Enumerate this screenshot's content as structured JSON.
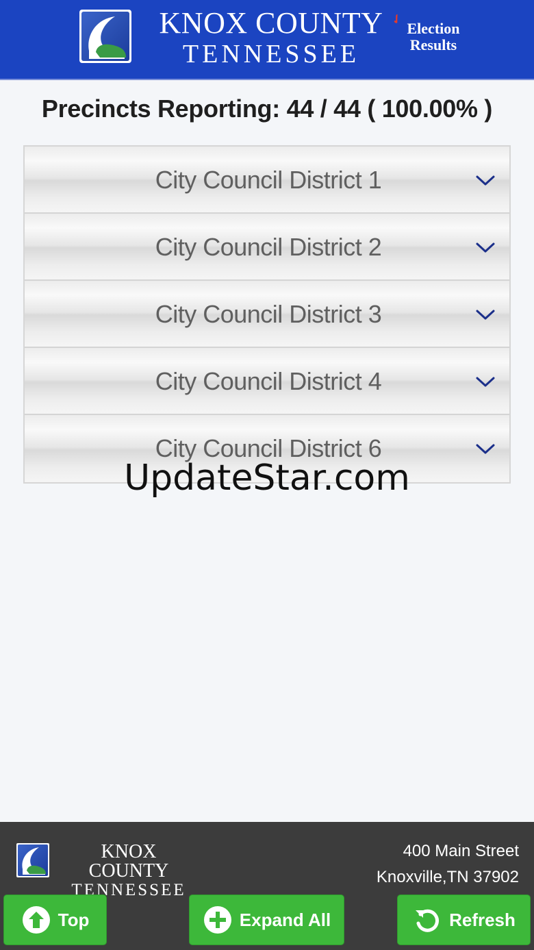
{
  "header": {
    "logo_icon": "knox-county-logo",
    "title_line1": "KNOX COUNTY",
    "title_line2": "TENNESSEE",
    "tag_line1": "Election",
    "tag_line2": "Results",
    "background_color": "#1b44c1"
  },
  "precincts": {
    "text": "Precincts Reporting: 44 / 44  ( 100.00% )"
  },
  "accordion": {
    "items": [
      {
        "label": "City Council District 1",
        "icon": "chevron-down-icon"
      },
      {
        "label": "City Council District 2",
        "icon": "chevron-down-icon"
      },
      {
        "label": "City Council District 3",
        "icon": "chevron-down-icon"
      },
      {
        "label": "City Council District 4",
        "icon": "chevron-down-icon"
      },
      {
        "label": "City Council District 6",
        "icon": "chevron-down-icon"
      }
    ],
    "chevron_color": "#1b2f8a"
  },
  "watermark": {
    "text": "UpdateStar.com"
  },
  "footer": {
    "logo_icon": "knox-county-logo",
    "title_line1": "KNOX COUNTY",
    "title_line2": "TENNESSEE",
    "address_line1": "400 Main Street",
    "address_line2": "Knoxville,TN 37902",
    "background_color": "#3c3c3c"
  },
  "buttons": {
    "top": {
      "label": "Top",
      "icon": "arrow-up-circle-icon"
    },
    "expand_all": {
      "label": "Expand All",
      "icon": "plus-circle-icon"
    },
    "refresh": {
      "label": "Refresh",
      "icon": "refresh-icon"
    },
    "color": "#3db83a"
  }
}
